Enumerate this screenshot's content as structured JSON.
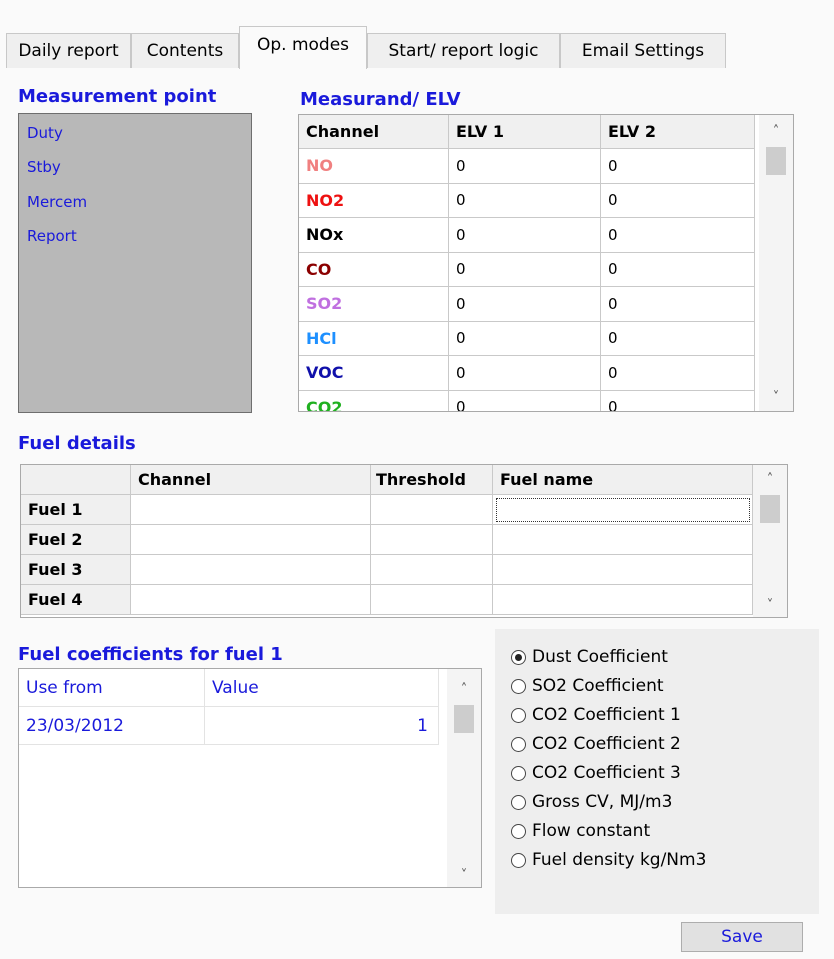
{
  "tabs": [
    {
      "label": "Daily report",
      "active": false
    },
    {
      "label": "Contents",
      "active": false
    },
    {
      "label": "Op. modes",
      "active": true
    },
    {
      "label": "Start/ report logic",
      "active": false
    },
    {
      "label": "Email Settings",
      "active": false
    }
  ],
  "measurement_point": {
    "title": "Measurement point",
    "items": [
      "Duty",
      "Stby",
      "Mercem",
      "Report"
    ]
  },
  "measurand": {
    "title": "Measurand/ ELV",
    "columns": [
      "Channel",
      "ELV 1",
      "ELV 2"
    ],
    "rows": [
      {
        "channel": "NO",
        "color": "#f08080",
        "elv1": "0",
        "elv2": "0"
      },
      {
        "channel": "NO2",
        "color": "#ee1111",
        "elv1": "0",
        "elv2": "0"
      },
      {
        "channel": "NOx",
        "color": "#000000",
        "elv1": "0",
        "elv2": "0"
      },
      {
        "channel": "CO",
        "color": "#8b0000",
        "elv1": "0",
        "elv2": "0"
      },
      {
        "channel": "SO2",
        "color": "#c070e0",
        "elv1": "0",
        "elv2": "0"
      },
      {
        "channel": "HCl",
        "color": "#1e90ff",
        "elv1": "0",
        "elv2": "0"
      },
      {
        "channel": "VOC",
        "color": "#1010aa",
        "elv1": "0",
        "elv2": "0"
      },
      {
        "channel": "CO2",
        "color": "#20b020",
        "elv1": "0",
        "elv2": "0"
      }
    ]
  },
  "fuel_details": {
    "title": "Fuel details",
    "columns": [
      "",
      "Channel",
      "Threshold",
      "Fuel name"
    ],
    "rows": [
      {
        "label": "Fuel 1",
        "channel": "",
        "threshold": "",
        "fuel_name": ""
      },
      {
        "label": "Fuel 2",
        "channel": "",
        "threshold": "",
        "fuel_name": ""
      },
      {
        "label": "Fuel 3",
        "channel": "",
        "threshold": "",
        "fuel_name": ""
      },
      {
        "label": "Fuel 4",
        "channel": "",
        "threshold": "",
        "fuel_name": ""
      }
    ]
  },
  "fuel_coefficients": {
    "title": "Fuel coefficients for fuel 1",
    "columns": [
      "Use from",
      "Value"
    ],
    "rows": [
      {
        "use_from": "23/03/2012",
        "value": "1"
      }
    ]
  },
  "coefficient_options": {
    "selected": 0,
    "options": [
      "Dust Coefficient",
      "SO2 Coefficient",
      "CO2 Coefficient 1",
      "CO2 Coefficient 2",
      "CO2 Coefficient 3",
      "Gross CV, MJ/m3",
      "Flow constant",
      "Fuel density kg/Nm3"
    ]
  },
  "save_label": "Save",
  "icons": {
    "scroll_up": "chevron-up-icon",
    "scroll_down": "chevron-down-icon"
  }
}
